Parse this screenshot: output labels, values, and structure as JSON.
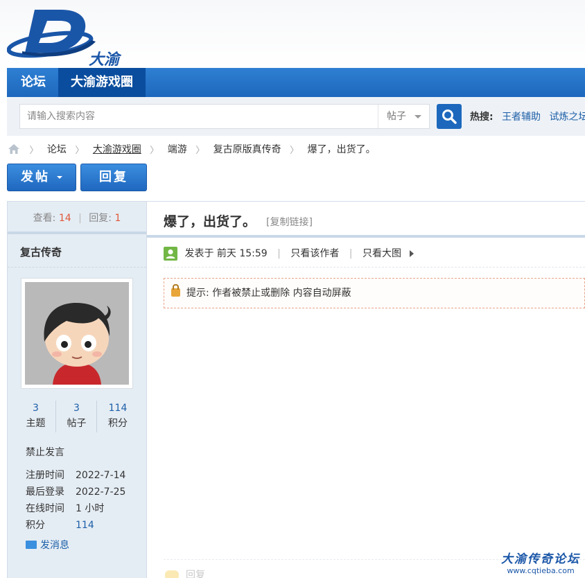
{
  "header": {
    "logo_text": "大渝",
    "nav": [
      {
        "label": "论坛",
        "active": false
      },
      {
        "label": "大渝游戏圈",
        "active": true
      }
    ]
  },
  "search": {
    "placeholder": "请输入搜索内容",
    "type_label": "帖子",
    "hot_label": "热搜:",
    "hot_links": [
      "王者辅助",
      "试炼之坛"
    ]
  },
  "breadcrumb": [
    "论坛",
    "大渝游戏圈",
    "端游",
    "复古原版真传奇",
    "爆了，出货了。"
  ],
  "actions": {
    "post_label": "发帖",
    "reply_label": "回复"
  },
  "sidebar": {
    "views_label": "查看:",
    "views": "14",
    "replies_label": "回复:",
    "replies": "1",
    "author": "复古传奇",
    "stats": [
      {
        "value": "3",
        "label": "主题"
      },
      {
        "value": "3",
        "label": "帖子"
      },
      {
        "value": "114",
        "label": "积分"
      }
    ],
    "status": "禁止发言",
    "info": [
      {
        "key": "注册时间",
        "value": "2022-7-14"
      },
      {
        "key": "最后登录",
        "value": "2022-7-25"
      },
      {
        "key": "在线时间",
        "value": "1 小时"
      },
      {
        "key": "积分",
        "value": "114"
      }
    ],
    "message_label": "发消息"
  },
  "post": {
    "title": "爆了，出货了。",
    "copy_link": "[复制链接]",
    "posted_label": "发表于 前天 15:59",
    "only_author": "只看该作者",
    "only_images": "只看大图",
    "notice": "提示: 作者被禁止或删除 内容自动屏蔽",
    "reply_faint": "回复"
  },
  "watermark": {
    "title": "大渝传奇论坛",
    "url": "www.cqtieba.com"
  },
  "colors": {
    "brand": "#1d68bd",
    "nav_active": "#0a4d9e",
    "link": "#1d5fa8",
    "highlight": "#e0573a"
  }
}
